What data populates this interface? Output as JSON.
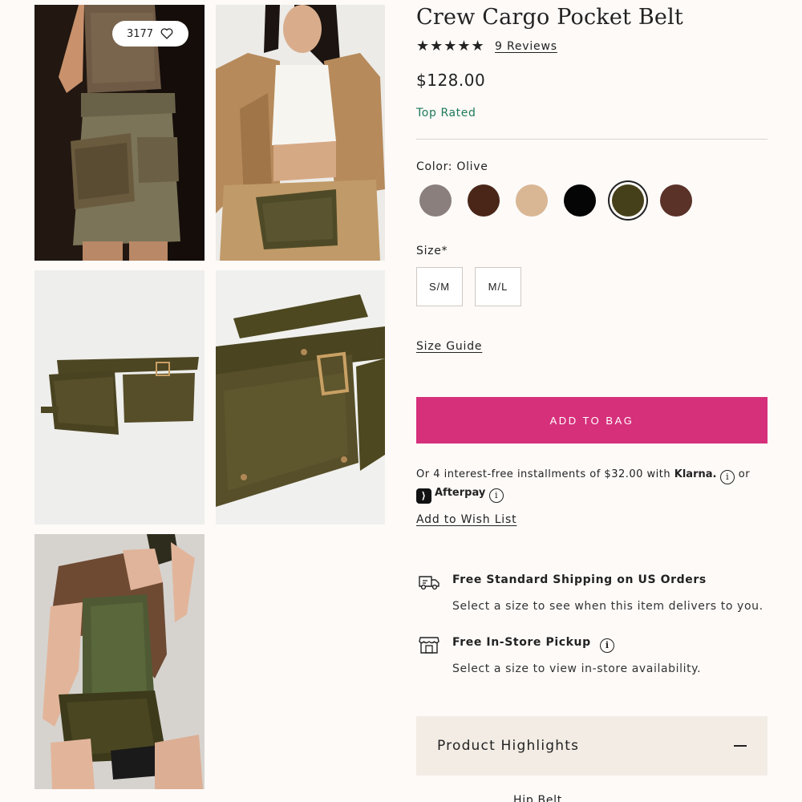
{
  "gallery": {
    "favorite_count": "3177",
    "photos": [
      {
        "icon": "model-photo-1"
      },
      {
        "icon": "model-photo-2"
      },
      {
        "icon": "product-flat-photo"
      },
      {
        "icon": "product-closeup-photo"
      },
      {
        "icon": "model-photo-3"
      }
    ]
  },
  "product": {
    "title": "Crew Cargo Pocket Belt",
    "rating_stars": "★★★★★",
    "rating": 5,
    "reviews_label": "9 Reviews",
    "price": "$128.00",
    "badge": "Top Rated"
  },
  "color": {
    "label": "Color: Olive",
    "swatches": [
      {
        "name": "Grey Suede",
        "hex": "#8a7f7c"
      },
      {
        "name": "Chocolate",
        "hex": "#4a2619"
      },
      {
        "name": "Tan",
        "hex": "#d9b795"
      },
      {
        "name": "Black",
        "hex": "#050505"
      },
      {
        "name": "Olive",
        "hex": "#45401a",
        "selected": true
      },
      {
        "name": "Brown",
        "hex": "#5a3228"
      }
    ]
  },
  "size": {
    "label": "Size*",
    "options": [
      "S/M",
      "M/L"
    ],
    "guide_label": "Size Guide"
  },
  "cart": {
    "add_label": "ADD TO BAG",
    "accent": "#d6307b"
  },
  "payment": {
    "prefix": "Or 4 interest-free installments of $32.00 with",
    "klarna": "Klarna.",
    "or": "or",
    "afterpay": "Afterpay"
  },
  "wishlist_label": "Add to Wish List",
  "shipping": {
    "standard_title": "Free Standard Shipping on US Orders",
    "standard_sub": "Select a size to see when this item delivers to you.",
    "pickup_title": "Free In-Store Pickup",
    "pickup_sub": "Select a size to view in-store availability."
  },
  "highlights": {
    "label": "Product Highlights",
    "next_text": "Hip Belt"
  }
}
